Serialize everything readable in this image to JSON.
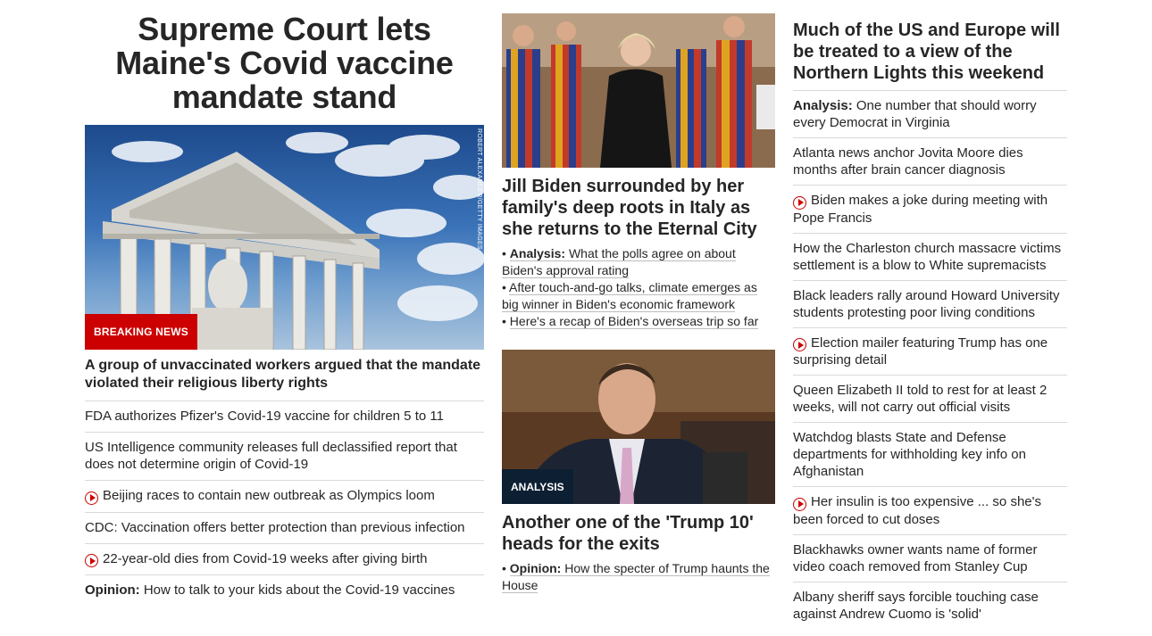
{
  "left": {
    "hero_title": "Supreme Court lets Maine's Covid vaccine mandate stand",
    "breaking_label": "BREAKING NEWS",
    "photo_credit": "ROBERT ALEXANDER/GETTY IMAGES",
    "hero_sub": "A group of unvaccinated workers argued that the mandate violated their religious liberty rights",
    "items": [
      {
        "text": "FDA authorizes Pfizer's Covid-19 vaccine for children 5 to 11",
        "video": false,
        "lead": ""
      },
      {
        "text": "US Intelligence community releases full declassified report that does not determine origin of Covid-19",
        "video": false,
        "lead": ""
      },
      {
        "text": "Beijing races to contain new outbreak as Olympics loom",
        "video": true,
        "lead": ""
      },
      {
        "text": "CDC: Vaccination offers better protection than previous infection",
        "video": false,
        "lead": ""
      },
      {
        "text": "22-year-old dies from Covid-19 weeks after giving birth",
        "video": true,
        "lead": ""
      },
      {
        "text": "How to talk to your kids about the Covid-19 vaccines",
        "video": false,
        "lead": "Opinion:"
      }
    ]
  },
  "mid": {
    "story1": {
      "title": "Jill Biden surrounded by her family's deep roots in Italy as she returns to the Eternal City",
      "bullets": [
        {
          "lead": "Analysis:",
          "text": "What the polls agree on about Biden's approval rating"
        },
        {
          "lead": "",
          "text": "After touch-and-go talks, climate emerges as big winner in Biden's economic framework"
        },
        {
          "lead": "",
          "text": "Here's a recap of Biden's overseas trip so far"
        }
      ]
    },
    "story2": {
      "tag": "ANALYSIS",
      "title": "Another one of the 'Trump 10' heads for the exits",
      "bullets": [
        {
          "lead": "Opinion:",
          "text": "How the specter of Trump haunts the House"
        }
      ]
    }
  },
  "right": {
    "title": "Much of the US and Europe will be treated to a view of the Northern Lights this weekend",
    "items": [
      {
        "lead": "Analysis:",
        "text": "One number that should worry every Democrat in Virginia",
        "video": false
      },
      {
        "lead": "",
        "text": "Atlanta news anchor Jovita Moore dies months after brain cancer diagnosis",
        "video": false
      },
      {
        "lead": "",
        "text": "Biden makes a joke during meeting with Pope Francis",
        "video": true
      },
      {
        "lead": "",
        "text": "How the Charleston church massacre victims settlement is a blow to White supremacists",
        "video": false
      },
      {
        "lead": "",
        "text": "Black leaders rally around Howard University students protesting poor living conditions",
        "video": false
      },
      {
        "lead": "",
        "text": "Election mailer featuring Trump has one surprising detail",
        "video": true
      },
      {
        "lead": "",
        "text": "Queen Elizabeth II told to rest for at least 2 weeks, will not carry out official visits",
        "video": false
      },
      {
        "lead": "",
        "text": "Watchdog blasts State and Defense departments for withholding key info on Afghanistan",
        "video": false
      },
      {
        "lead": "",
        "text": "Her insulin is too expensive ... so she's been forced to cut doses",
        "video": true
      },
      {
        "lead": "",
        "text": "Blackhawks owner wants name of former video coach removed from Stanley Cup",
        "video": false
      },
      {
        "lead": "",
        "text": "Albany sheriff says forcible touching case against Andrew Cuomo is 'solid'",
        "video": false
      }
    ]
  },
  "colors": {
    "accent_red": "#cc0000",
    "analysis_navy": "#0c1f33",
    "text": "#262626",
    "divider": "#d9d9d9"
  }
}
